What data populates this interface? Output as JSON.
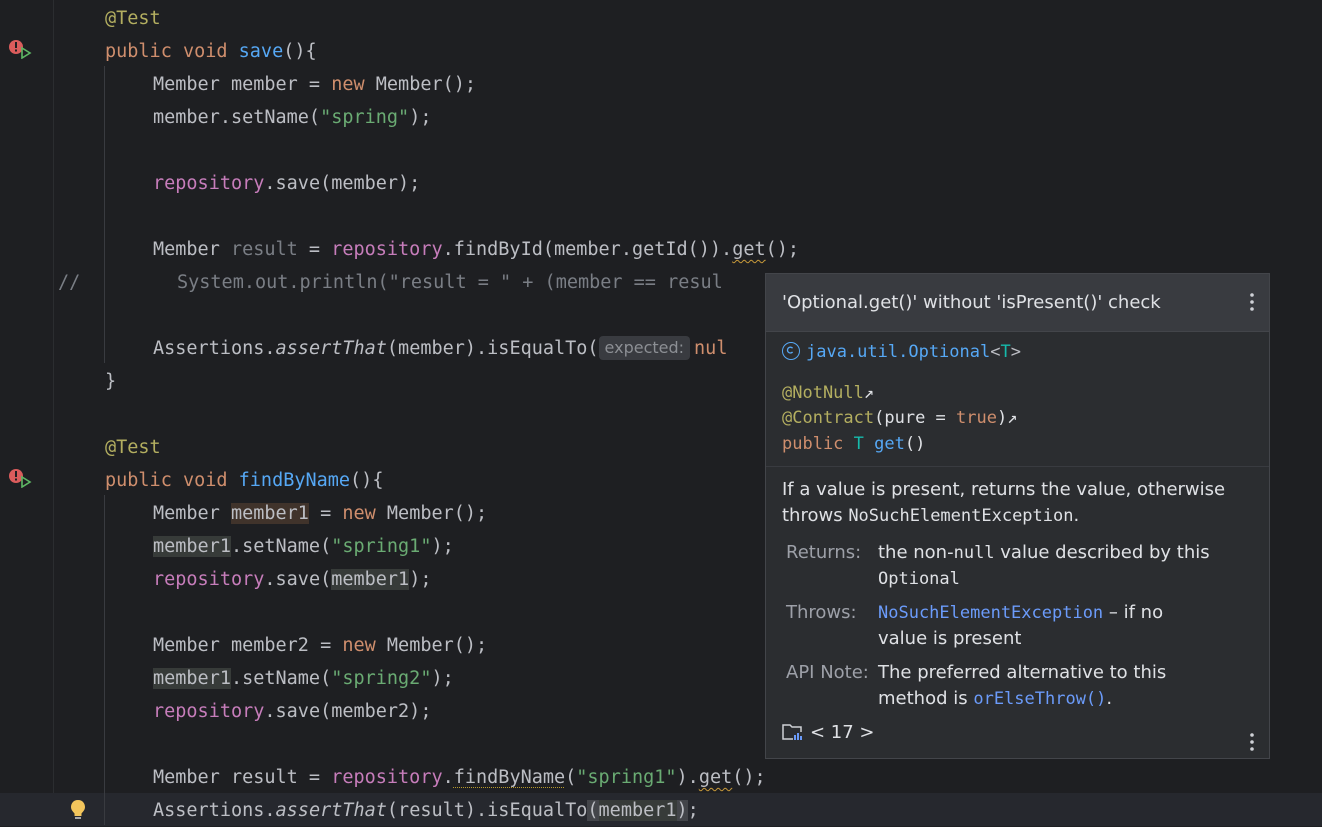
{
  "editor": {
    "lines": [
      {
        "ann": "@Test"
      },
      {
        "kw": "public void ",
        "fn": "save",
        "rest": "(){"
      },
      {
        "t1": "Member member = ",
        "kw": "new",
        "t2": " Member();"
      },
      {
        "t1": "member.setName(",
        "str": "\"spring\"",
        "t2": ");"
      },
      {
        "fld": "repository",
        "t2": ".save(member);"
      },
      {
        "t1": "Member ",
        "unused": "result",
        "t2": " = ",
        "fld": "repository",
        "t3": ".findById(member.getId()).",
        "warn": "get",
        "t4": "();"
      },
      {
        "comment_mark": "//",
        "t1": "System.out.println(\"result = \" + (member == resul"
      },
      {
        "t1": "Assertions.",
        "it": "assertThat",
        "t2": "(member).isEqualTo(",
        "hint": "expected:",
        "t3": "nul"
      },
      {
        "t1": "}"
      },
      {
        "ann": "@Test"
      },
      {
        "kw": "public void ",
        "fn": "findByName",
        "rest": "(){"
      },
      {
        "t1": "Member ",
        "hl": "member1",
        "t2": " = ",
        "kw": "new",
        "t3": " Member();"
      },
      {
        "hl": "member1",
        "t1": ".setName(",
        "str": "\"spring1\"",
        "t2": ");"
      },
      {
        "fld": "repository",
        "t1": ".save(",
        "hl": "member1",
        "t2": ");"
      },
      {
        "t1": "Member member2 = ",
        "kw": "new",
        "t2": " Member();"
      },
      {
        "hl": "member1",
        "t1": ".setName(",
        "str": "\"spring2\"",
        "t2": ");"
      },
      {
        "fld": "repository",
        "t1": ".save(member2);"
      },
      {
        "t1": "Member result = ",
        "fld": "repository",
        "t2": ".",
        "warn_fn": "findByName",
        "t3": "(",
        "str": "\"spring1\"",
        "t4": ").",
        "warn": "get",
        "t5": "();"
      },
      {
        "t1": "Assertions.",
        "it": "assertThat",
        "t2": "(result).isEqualTo",
        "b1": "(",
        "t3": "member1",
        "b2": ")",
        "t4": ";"
      }
    ]
  },
  "popup": {
    "title": "'Optional.get()' without 'isPresent()' check",
    "class_name": "java.util.Optional",
    "class_generic_open": "<",
    "class_generic_t": "T",
    "class_generic_close": ">",
    "sig_notnull": "@NotNull",
    "sig_contract": "@Contract",
    "sig_contract_args_open": "(pure = ",
    "sig_contract_true": "true",
    "sig_contract_args_close": ")",
    "sig_arrow": "↗",
    "sig_public": "public",
    "sig_type": "T",
    "sig_method": "get",
    "sig_parens": "()",
    "desc_1": "If a value is present, returns the value, otherwise",
    "desc_2_a": "throws ",
    "desc_2_code": "NoSuchElementException",
    "desc_2_b": ".",
    "returns_label": "Returns:",
    "returns_a": "the non-",
    "returns_code": "null",
    "returns_b": " value described by this",
    "returns_code2": "Optional",
    "throws_label": "Throws:",
    "throws_link": "NoSuchElementException",
    "throws_a": " – if no",
    "throws_b": "value is present",
    "apinote_label": "API Note:",
    "apinote_a": "The preferred alternative to this",
    "apinote_b": "method is ",
    "apinote_link": "orElseThrow()",
    "apinote_c": ".",
    "version": "< 17 >"
  },
  "colors": {
    "background": "#1e1f22",
    "keyword": "#cf8e6d",
    "annotation": "#b3ae60",
    "function": "#56a8f5",
    "field": "#c77dbb",
    "string": "#6aab73",
    "link": "#6b9bfa"
  }
}
